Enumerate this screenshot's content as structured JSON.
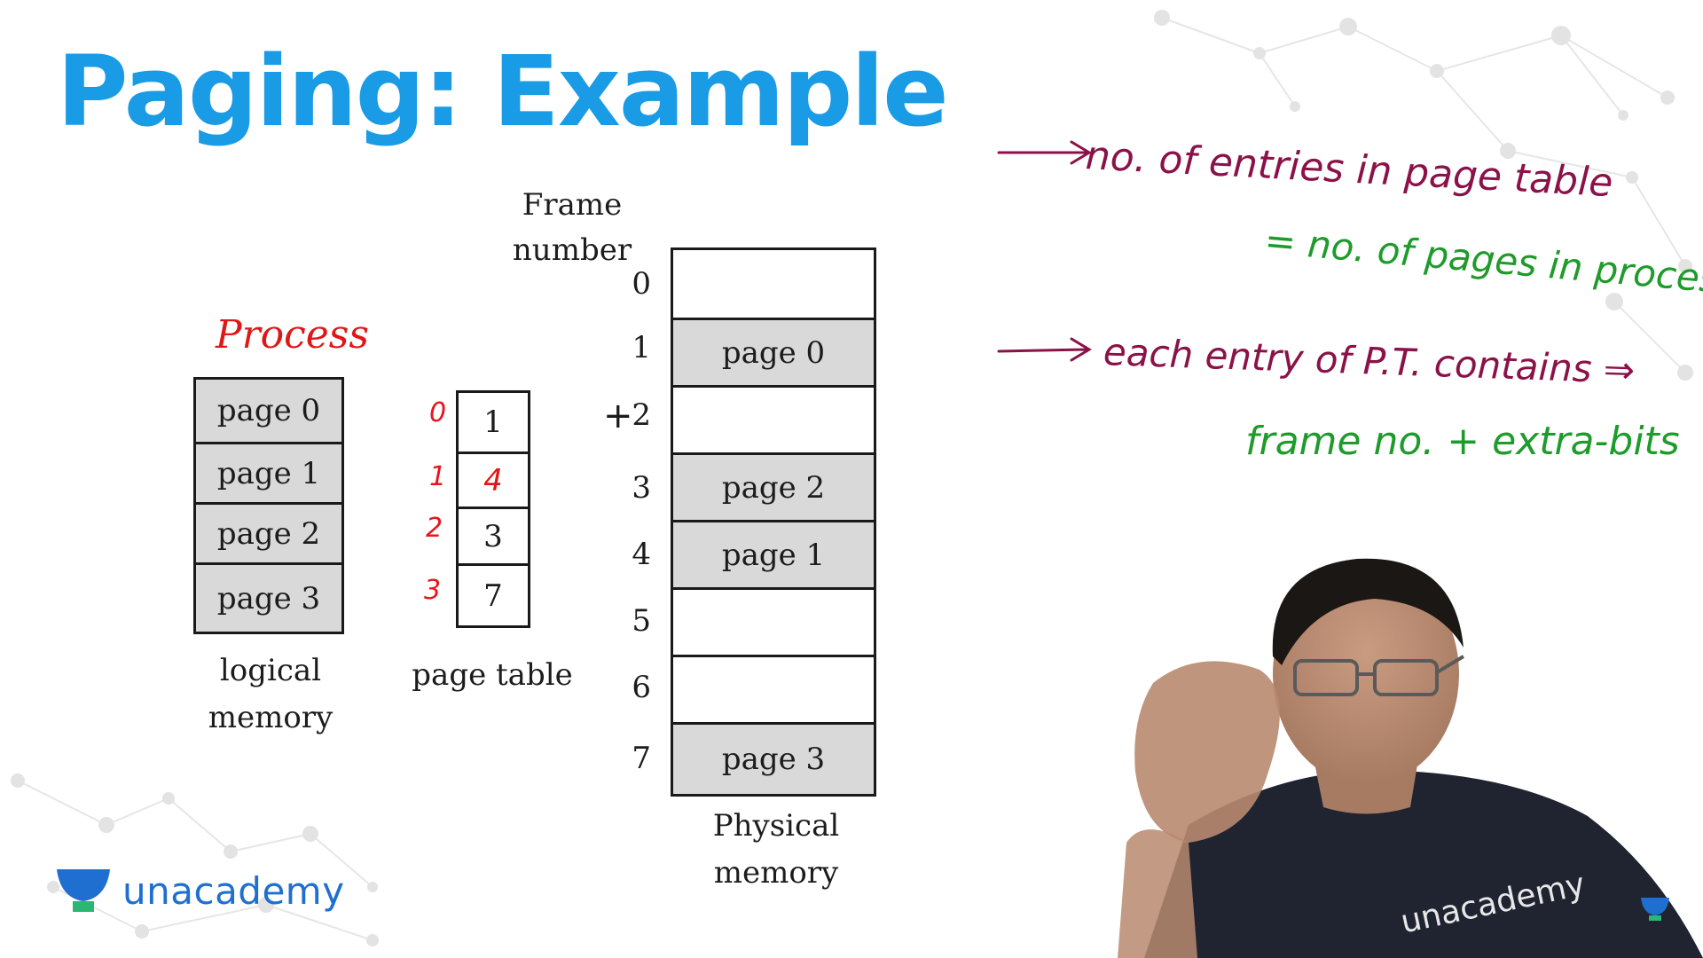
{
  "slide": {
    "title": "Paging: Example",
    "process_label": "Process",
    "logical_memory": {
      "pages": [
        "page 0",
        "page 1",
        "page 2",
        "page 3"
      ],
      "caption_line1": "logical",
      "caption_line2": "memory"
    },
    "page_table": {
      "indices": [
        "0",
        "1",
        "2",
        "3"
      ],
      "entries": [
        "1",
        "4",
        "3",
        "7"
      ],
      "caption": "page table"
    },
    "physical_memory": {
      "header_line1": "Frame",
      "header_line2": "number",
      "frame_numbers": [
        "0",
        "1",
        "2",
        "3",
        "4",
        "5",
        "6",
        "7"
      ],
      "frames": [
        "",
        "page 0",
        "",
        "page 2",
        "page 1",
        "",
        "",
        "page 3"
      ],
      "caption_line1": "Physical",
      "caption_line2": "memory"
    }
  },
  "annotations": {
    "note1_line1": "no. of entries in page table",
    "note1_line2": "= no. of pages in process",
    "note2_line1": "each entry of P.T. contains ⇒",
    "note2_line2": "frame no. + extra-bits"
  },
  "branding": {
    "logo_text": "unacademy",
    "shirt_text": "unacademy"
  },
  "colors": {
    "title": "#1a9be6",
    "frame_fill": "#d9d9d9",
    "handwriting_maroon": "#8b1248",
    "handwriting_green": "#1e9b2a",
    "handwriting_red": "#e01717",
    "brand_blue": "#1f6fd0",
    "brand_green": "#2bb673"
  }
}
